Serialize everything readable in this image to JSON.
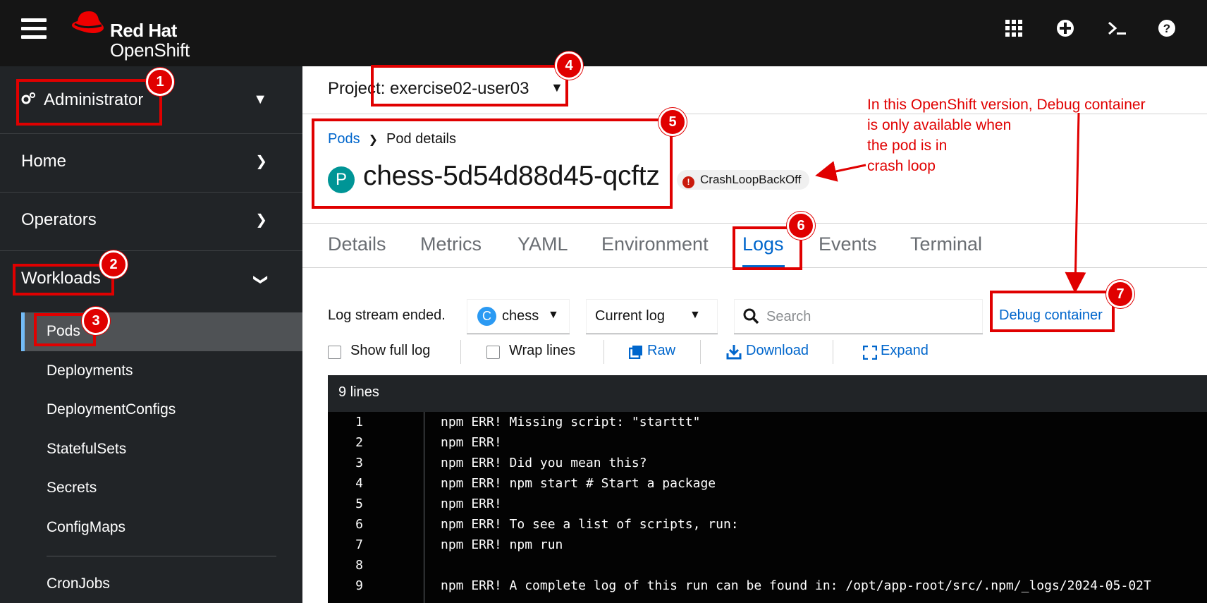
{
  "masthead": {
    "brand_line1": "Red Hat",
    "brand_line2": "OpenShift",
    "icons": [
      "app-launcher-icon",
      "plus-circle-icon",
      "terminal-icon",
      "help-icon"
    ]
  },
  "sidebar": {
    "perspective": "Administrator",
    "sections": [
      {
        "label": "Home"
      },
      {
        "label": "Operators"
      },
      {
        "label": "Workloads"
      }
    ],
    "workloads_items": [
      {
        "label": "Pods",
        "active": true
      },
      {
        "label": "Deployments"
      },
      {
        "label": "DeploymentConfigs"
      },
      {
        "label": "StatefulSets"
      },
      {
        "label": "Secrets"
      },
      {
        "label": "ConfigMaps"
      },
      {
        "label": "CronJobs"
      }
    ]
  },
  "project": {
    "label": "Project: exercise02-user03"
  },
  "breadcrumb": {
    "parent": "Pods",
    "current": "Pod details"
  },
  "pod": {
    "badge": "P",
    "name": "chess-5d54d88d45-qcftz",
    "status": "CrashLoopBackOff",
    "status_color": "#c9190b"
  },
  "tabs": [
    "Details",
    "Metrics",
    "YAML",
    "Environment",
    "Logs",
    "Events",
    "Terminal"
  ],
  "active_tab": "Logs",
  "logs_toolbar": {
    "stream_status": "Log stream ended.",
    "container_badge": "C",
    "container": "chess",
    "log_type": "Current log",
    "search_placeholder": "Search",
    "debug_link": "Debug container",
    "show_full_log": "Show full log",
    "wrap_lines": "Wrap lines",
    "raw": "Raw",
    "download": "Download",
    "expand": "Expand"
  },
  "log": {
    "header": "9 lines",
    "lines": [
      {
        "num": "1",
        "text": "npm ERR! Missing script: \"starttt\""
      },
      {
        "num": "2",
        "text": "npm ERR!"
      },
      {
        "num": "3",
        "text": "npm ERR! Did you mean this?"
      },
      {
        "num": "4",
        "text": "npm ERR! npm start # Start a package"
      },
      {
        "num": "5",
        "text": "npm ERR!"
      },
      {
        "num": "6",
        "text": "npm ERR! To see a list of scripts, run:"
      },
      {
        "num": "7",
        "text": "npm ERR! npm run"
      },
      {
        "num": "8",
        "text": ""
      },
      {
        "num": "9",
        "text": "npm ERR! A complete log of this run can be found in: /opt/app-root/src/.npm/_logs/2024-05-02T"
      }
    ]
  },
  "annotations": {
    "numbers": [
      "1",
      "2",
      "3",
      "4",
      "5",
      "6",
      "7"
    ],
    "note": [
      "In this OpenShift version, Debug container",
      "is only available when",
      "the pod is in",
      "crash loop"
    ],
    "color": "#e00000"
  }
}
